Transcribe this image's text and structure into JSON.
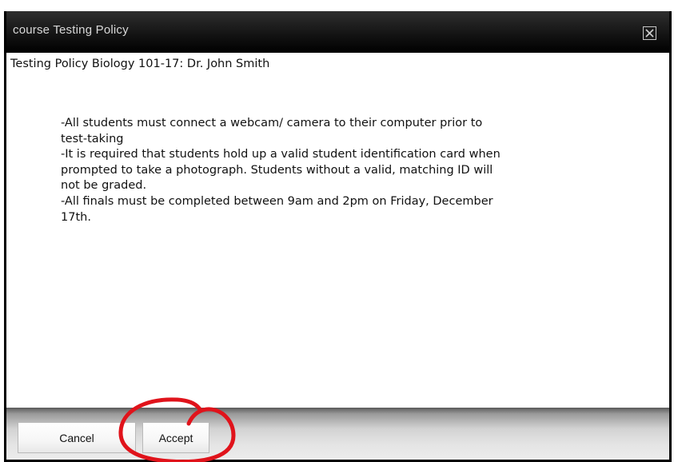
{
  "dialog": {
    "title": "course Testing Policy",
    "close_icon": "close-icon",
    "heading": "Testing Policy Biology 101-17: Dr. John Smith",
    "policy_lines": [
      "-All students must connect a webcam/ camera to their computer prior to",
      "test-taking",
      "-It is required that students hold up a valid student identification card when",
      "prompted to take a photograph. Students without a valid, matching ID will",
      "not be graded.",
      "-All finals must be completed between 9am and 2pm on Friday, December",
      "17th."
    ]
  },
  "footer": {
    "cancel_label": "Cancel",
    "accept_label": "Accept"
  },
  "colors": {
    "titlebar": "#141414",
    "title_text": "#d8d8d8",
    "highlight_ring": "#e0131b"
  }
}
